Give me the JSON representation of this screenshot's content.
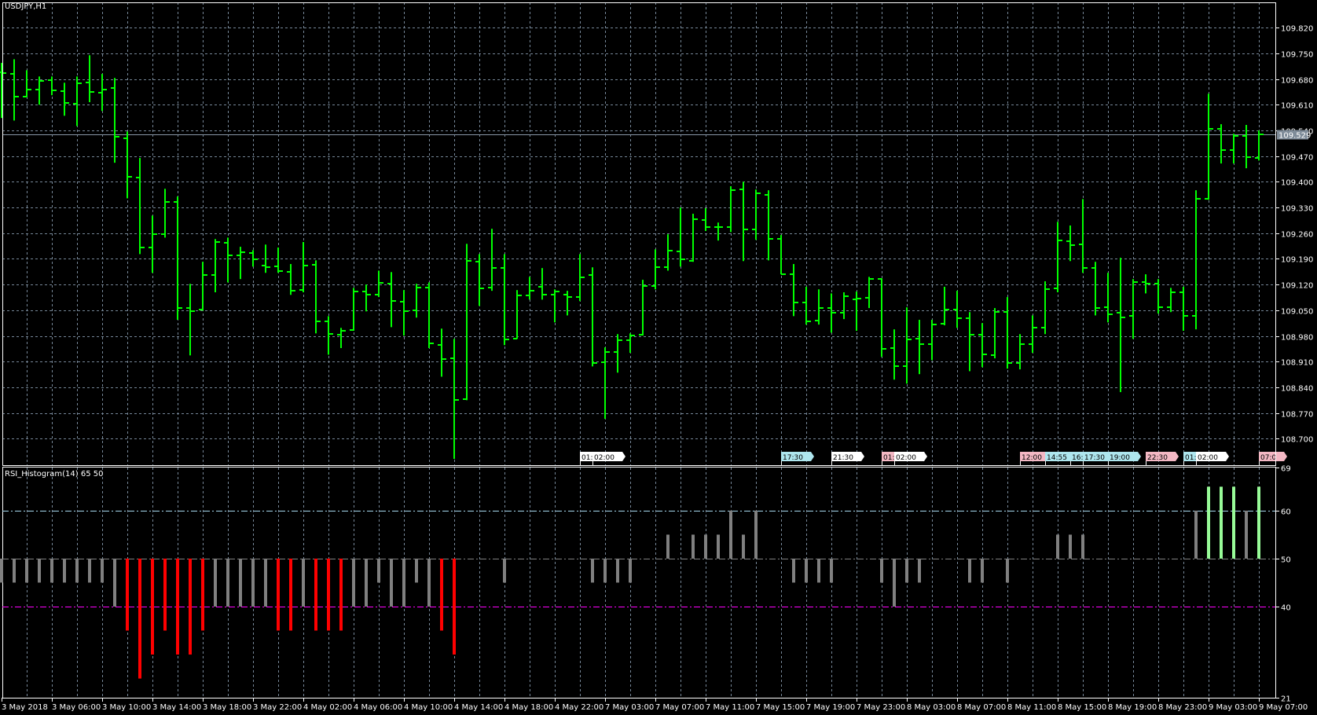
{
  "window": {
    "symbol_title": "USDJPY,H1",
    "indicator_title": "RSI_Histogram(14) 65 50"
  },
  "colors": {
    "background": "#000000",
    "frame": "#ffffff",
    "grid": "#778899",
    "bar": "#00ff00",
    "bid_line": "#8a99a8",
    "bid_label_bg": "#7f8c99",
    "hist_neutral": "#808080",
    "hist_low": "#ff0000",
    "hist_high": "#98fb98",
    "level_60": "#a6d8ee",
    "level_50": "#808080",
    "level_40": "#ff00ff"
  },
  "chart_data": [
    {
      "type": "ohlc",
      "title": "USDJPY,H1",
      "ylim": [
        108.628,
        109.889
      ],
      "y_ticks": [
        "109.820",
        "109.750",
        "109.680",
        "109.610",
        "109.540",
        "109.470",
        "109.400",
        "109.330",
        "109.260",
        "109.190",
        "109.120",
        "109.050",
        "108.980",
        "108.910",
        "108.840",
        "108.770",
        "108.700"
      ],
      "current_price": "109.529",
      "x_tick_labels": [
        {
          "bar": 0,
          "label": "3 May 2018"
        },
        {
          "bar": 4,
          "label": "3 May 06:00"
        },
        {
          "bar": 8,
          "label": "3 May 10:00"
        },
        {
          "bar": 12,
          "label": "3 May 14:00"
        },
        {
          "bar": 16,
          "label": "3 May 18:00"
        },
        {
          "bar": 20,
          "label": "3 May 22:00"
        },
        {
          "bar": 24,
          "label": "4 May 02:00"
        },
        {
          "bar": 28,
          "label": "4 May 06:00"
        },
        {
          "bar": 32,
          "label": "4 May 10:00"
        },
        {
          "bar": 36,
          "label": "4 May 14:00"
        },
        {
          "bar": 40,
          "label": "4 May 18:00"
        },
        {
          "bar": 44,
          "label": "4 May 22:00"
        },
        {
          "bar": 48,
          "label": "7 May 03:00"
        },
        {
          "bar": 52,
          "label": "7 May 07:00"
        },
        {
          "bar": 56,
          "label": "7 May 11:00"
        },
        {
          "bar": 60,
          "label": "7 May 15:00"
        },
        {
          "bar": 64,
          "label": "7 May 19:00"
        },
        {
          "bar": 68,
          "label": "7 May 23:00"
        },
        {
          "bar": 72,
          "label": "8 May 03:00"
        },
        {
          "bar": 76,
          "label": "8 May 07:00"
        },
        {
          "bar": 80,
          "label": "8 May 11:00"
        },
        {
          "bar": 84,
          "label": "8 May 15:00"
        },
        {
          "bar": 88,
          "label": "8 May 19:00"
        },
        {
          "bar": 92,
          "label": "8 May 23:00"
        },
        {
          "bar": 96,
          "label": "9 May 03:00"
        },
        {
          "bar": 100,
          "label": "9 May 07:00"
        }
      ],
      "ohlc": [
        [
          109.698,
          109.724,
          109.574,
          109.696
        ],
        [
          109.694,
          109.734,
          109.567,
          109.632
        ],
        [
          109.632,
          109.704,
          109.63,
          109.651
        ],
        [
          109.651,
          109.687,
          109.61,
          109.674
        ],
        [
          109.677,
          109.687,
          109.636,
          109.649
        ],
        [
          109.647,
          109.67,
          109.58,
          109.615
        ],
        [
          109.612,
          109.687,
          109.552,
          109.668
        ],
        [
          109.67,
          109.745,
          109.617,
          109.645
        ],
        [
          109.642,
          109.694,
          109.593,
          109.651
        ],
        [
          109.655,
          109.683,
          109.452,
          109.522
        ],
        [
          109.518,
          109.537,
          109.355,
          109.413
        ],
        [
          109.411,
          109.465,
          109.203,
          109.221
        ],
        [
          109.221,
          109.308,
          109.152,
          109.257
        ],
        [
          109.257,
          109.381,
          109.248,
          109.345
        ],
        [
          109.345,
          109.36,
          109.024,
          109.056
        ],
        [
          109.056,
          109.122,
          108.927,
          109.047
        ],
        [
          109.051,
          109.182,
          109.049,
          109.146
        ],
        [
          109.146,
          109.244,
          109.099,
          109.236
        ],
        [
          109.233,
          109.248,
          109.126,
          109.199
        ],
        [
          109.199,
          109.223,
          109.135,
          109.208
        ],
        [
          109.206,
          109.214,
          109.169,
          109.188
        ],
        [
          109.171,
          109.229,
          109.152,
          109.167
        ],
        [
          109.169,
          109.221,
          109.152,
          109.156
        ],
        [
          109.154,
          109.176,
          109.092,
          109.103
        ],
        [
          109.105,
          109.236,
          109.099,
          109.171
        ],
        [
          109.173,
          109.186,
          108.987,
          109.019
        ],
        [
          109.019,
          109.034,
          108.929,
          108.985
        ],
        [
          108.983,
          109.002,
          108.947,
          108.994
        ],
        [
          108.996,
          109.111,
          108.994,
          109.101
        ],
        [
          109.101,
          109.12,
          109.047,
          109.092
        ],
        [
          109.092,
          109.158,
          109.086,
          109.124
        ],
        [
          109.122,
          109.154,
          109.004,
          109.075
        ],
        [
          109.073,
          109.105,
          108.981,
          109.047
        ],
        [
          109.049,
          109.122,
          109.03,
          109.111
        ],
        [
          109.111,
          109.126,
          108.947,
          108.959
        ],
        [
          108.955,
          109.0,
          108.869,
          108.917
        ],
        [
          108.919,
          108.972,
          108.645,
          108.805
        ],
        [
          108.807,
          109.231,
          108.805,
          109.184
        ],
        [
          109.182,
          109.203,
          109.062,
          109.109
        ],
        [
          109.111,
          109.272,
          109.103,
          109.165
        ],
        [
          109.165,
          109.203,
          108.955,
          108.97
        ],
        [
          108.972,
          109.105,
          108.972,
          109.09
        ],
        [
          109.09,
          109.141,
          109.079,
          109.103
        ],
        [
          109.114,
          109.165,
          109.079,
          109.092
        ],
        [
          109.092,
          109.107,
          109.017,
          109.101
        ],
        [
          109.092,
          109.103,
          109.036,
          109.086
        ],
        [
          109.086,
          109.203,
          109.075,
          109.139
        ],
        [
          109.146,
          109.167,
          108.897,
          108.906
        ],
        [
          108.908,
          108.949,
          108.754,
          108.936
        ],
        [
          108.936,
          108.985,
          108.88,
          108.968
        ],
        [
          108.968,
          108.987,
          108.934,
          108.981
        ],
        [
          108.983,
          109.133,
          108.981,
          109.116
        ],
        [
          109.116,
          109.216,
          109.107,
          109.167
        ],
        [
          109.167,
          109.257,
          109.158,
          109.212
        ],
        [
          109.21,
          109.33,
          109.169,
          109.188
        ],
        [
          109.184,
          109.313,
          109.182,
          109.298
        ],
        [
          109.296,
          109.328,
          109.266,
          109.276
        ],
        [
          109.276,
          109.289,
          109.24,
          109.276
        ],
        [
          109.276,
          109.388,
          109.263,
          109.377
        ],
        [
          109.379,
          109.4,
          109.184,
          109.27
        ],
        [
          109.27,
          109.379,
          109.242,
          109.368
        ],
        [
          109.364,
          109.377,
          109.186,
          109.244
        ],
        [
          109.244,
          109.255,
          109.148,
          109.148
        ],
        [
          109.148,
          109.176,
          109.034,
          109.071
        ],
        [
          109.071,
          109.114,
          109.011,
          109.019
        ],
        [
          109.021,
          109.107,
          109.011,
          109.056
        ],
        [
          109.056,
          109.096,
          108.989,
          109.043
        ],
        [
          109.043,
          109.099,
          109.026,
          109.088
        ],
        [
          109.079,
          109.101,
          108.994,
          109.081
        ],
        [
          109.084,
          109.141,
          109.056,
          109.135
        ],
        [
          109.135,
          109.137,
          108.923,
          108.944
        ],
        [
          108.947,
          108.998,
          108.861,
          108.897
        ],
        [
          108.897,
          109.058,
          108.85,
          108.97
        ],
        [
          108.972,
          109.024,
          108.876,
          108.957
        ],
        [
          108.957,
          109.024,
          108.914,
          109.011
        ],
        [
          109.013,
          109.114,
          109.009,
          109.051
        ],
        [
          109.051,
          109.103,
          109.002,
          109.028
        ],
        [
          109.028,
          109.045,
          108.884,
          108.983
        ],
        [
          108.983,
          109.015,
          108.895,
          108.929
        ],
        [
          108.927,
          109.056,
          108.919,
          109.045
        ],
        [
          109.045,
          109.086,
          108.891,
          108.906
        ],
        [
          108.906,
          108.985,
          108.889,
          108.957
        ],
        [
          108.957,
          109.036,
          108.934,
          109.002
        ],
        [
          109.002,
          109.129,
          108.985,
          109.107
        ],
        [
          109.109,
          109.291,
          109.099,
          109.24
        ],
        [
          109.238,
          109.281,
          109.184,
          109.227
        ],
        [
          109.229,
          109.353,
          109.152,
          109.165
        ],
        [
          109.165,
          109.182,
          109.036,
          109.056
        ],
        [
          109.058,
          109.152,
          109.017,
          109.039
        ],
        [
          109.043,
          109.193,
          108.827,
          109.03
        ],
        [
          109.034,
          109.135,
          108.972,
          109.126
        ],
        [
          109.126,
          109.148,
          109.096,
          109.122
        ],
        [
          109.122,
          109.135,
          109.041,
          109.058
        ],
        [
          109.058,
          109.111,
          109.045,
          109.099
        ],
        [
          109.099,
          109.114,
          108.994,
          109.034
        ],
        [
          109.034,
          109.377,
          108.998,
          109.353
        ],
        [
          109.353,
          109.64,
          109.351,
          109.544
        ],
        [
          109.544,
          109.557,
          109.45,
          109.486
        ],
        [
          109.486,
          109.531,
          109.45,
          109.525
        ],
        [
          109.525,
          109.555,
          109.437,
          109.467
        ],
        [
          109.465,
          109.54,
          109.458,
          109.529
        ]
      ],
      "event_flags": [
        {
          "bar": 46,
          "text": "01:",
          "color": "#ffffff"
        },
        {
          "bar": 47,
          "text": "02:00",
          "color": "#ffffff"
        },
        {
          "bar": 62,
          "text": "17:30",
          "color": "#aee6ee"
        },
        {
          "bar": 66,
          "text": "21:30",
          "color": "#ffffff"
        },
        {
          "bar": 70,
          "text": "01:",
          "color": "#f4b8c4"
        },
        {
          "bar": 71,
          "text": "02:00",
          "color": "#ffffff"
        },
        {
          "bar": 81,
          "text": "12:00",
          "color": "#f4b8c4"
        },
        {
          "bar": 83,
          "text": "14:55",
          "color": "#aee6ee"
        },
        {
          "bar": 85,
          "text": "16:",
          "color": "#aee6ee"
        },
        {
          "bar": 86,
          "text": "17:30",
          "color": "#aee6ee"
        },
        {
          "bar": 88,
          "text": "19:00",
          "color": "#aee6ee"
        },
        {
          "bar": 91,
          "text": "22:30",
          "color": "#f4b8c4"
        },
        {
          "bar": 94,
          "text": "01:",
          "color": "#aee6ee"
        },
        {
          "bar": 95,
          "text": "02:00",
          "color": "#ffffff"
        },
        {
          "bar": 100,
          "text": "07:0",
          "color": "#f4b8c4"
        }
      ]
    },
    {
      "type": "bar",
      "title": "RSI_Histogram(14) 65 50",
      "ylim": [
        21,
        69
      ],
      "baseline": 50,
      "y_ticks": [
        "69",
        "60",
        "50",
        "40",
        "21"
      ],
      "levels": [
        60,
        50,
        40
      ],
      "thresholds": {
        "high": 65,
        "low": 35
      },
      "values": [
        45,
        45,
        45,
        45,
        45,
        45,
        45,
        45,
        45,
        40,
        35,
        25,
        30,
        35,
        30,
        30,
        35,
        40,
        40,
        40,
        40,
        40,
        35,
        35,
        40,
        35,
        35,
        35,
        40,
        40,
        45,
        40,
        40,
        45,
        40,
        35,
        30,
        50,
        50,
        50,
        45,
        50,
        50,
        50,
        50,
        50,
        50,
        45,
        45,
        45,
        45,
        50,
        50,
        55,
        50,
        55,
        55,
        55,
        60,
        55,
        60,
        50,
        50,
        45,
        45,
        45,
        45,
        50,
        50,
        50,
        45,
        40,
        45,
        45,
        50,
        50,
        50,
        45,
        45,
        50,
        45,
        50,
        50,
        50,
        55,
        55,
        55,
        50,
        50,
        50,
        50,
        50,
        50,
        50,
        50,
        60,
        65,
        65,
        65,
        60,
        65
      ]
    }
  ]
}
